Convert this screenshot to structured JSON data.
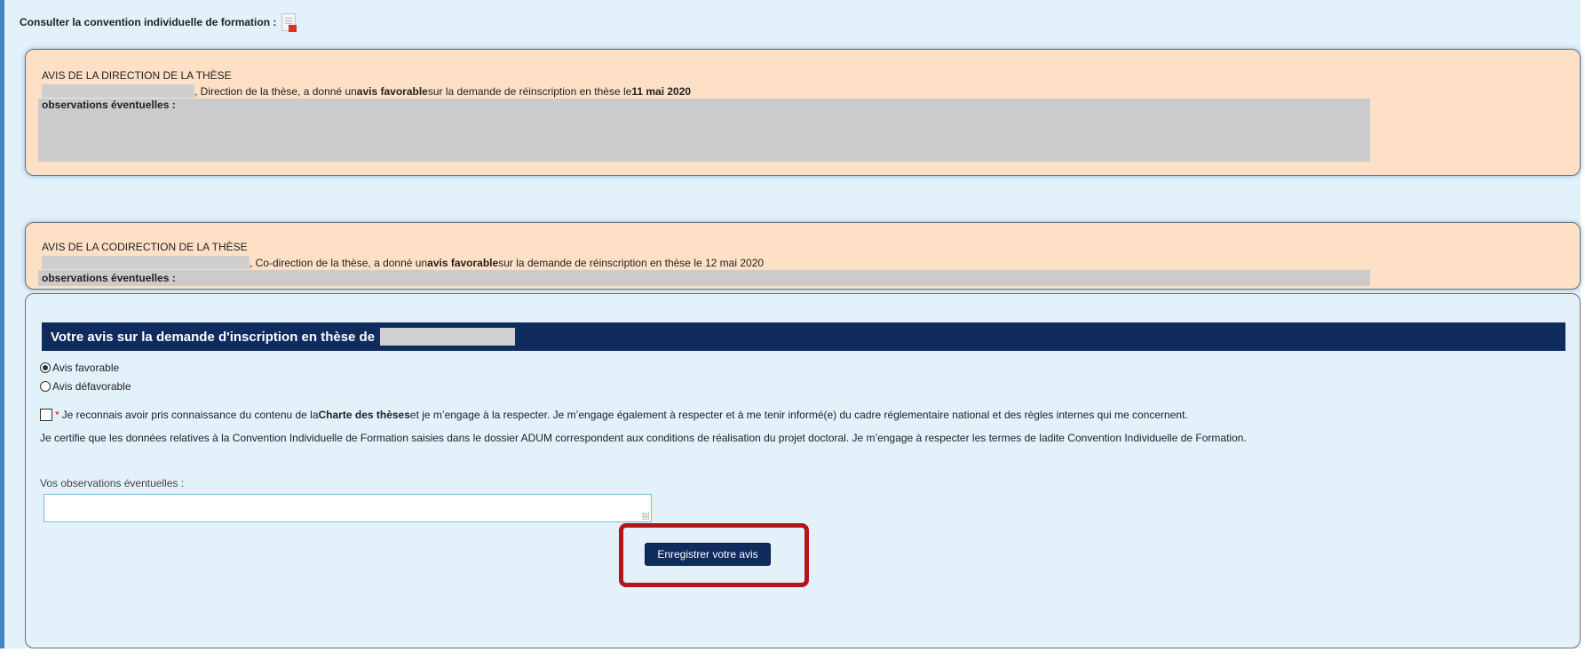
{
  "consult": {
    "label": "Consulter la convention individuelle de formation :",
    "icon": "pdf-icon"
  },
  "direction": {
    "title": "AVIS DE LA DIRECTION DE LA THÈSE",
    "role_text": ", Direction de la thèse, a donné un ",
    "avis": "avis favorable",
    "tail": " sur la demande de réinscription en thèse le ",
    "date": "11 mai 2020",
    "obs_label": "observations éventuelles :"
  },
  "codirection": {
    "title": "AVIS DE LA CODIRECTION DE LA THÈSE",
    "role_text": ", Co-direction de la thèse, a donné un ",
    "avis": "avis favorable",
    "tail": " sur la demande de réinscription en thèse le 12 mai 2020",
    "obs_label": "observations éventuelles :"
  },
  "form": {
    "header": "Votre avis sur la demande d'inscription en thèse de",
    "radio_favorable": "Avis favorable",
    "radio_defavorable": "Avis défavorable",
    "selected": "Avis favorable",
    "charter_required": "*",
    "charter_pre": "Je reconnais avoir pris connaissance du contenu de la ",
    "charter_bold": "Charte des thèses",
    "charter_post": " et je m’engage à la respecter. Je m’engage également à respecter et à me tenir informé(e) du cadre réglementaire national et des règles internes qui me concernent.",
    "certify": "Je certifie que les données relatives à la Convention Individuelle de Formation saisies dans le dossier ADUM correspondent aux conditions de réalisation du projet doctoral. Je m’engage à respecter les termes de ladite Convention Individuelle de Formation.",
    "obs_label": "Vos observations éventuelles :",
    "obs_value": "",
    "save_label": "Enregistrer votre avis"
  },
  "colors": {
    "accent_navy": "#102b5e",
    "avis_box": "#fde0c6",
    "page_bg": "#e3f1fb",
    "highlight_red": "#b5141b"
  }
}
